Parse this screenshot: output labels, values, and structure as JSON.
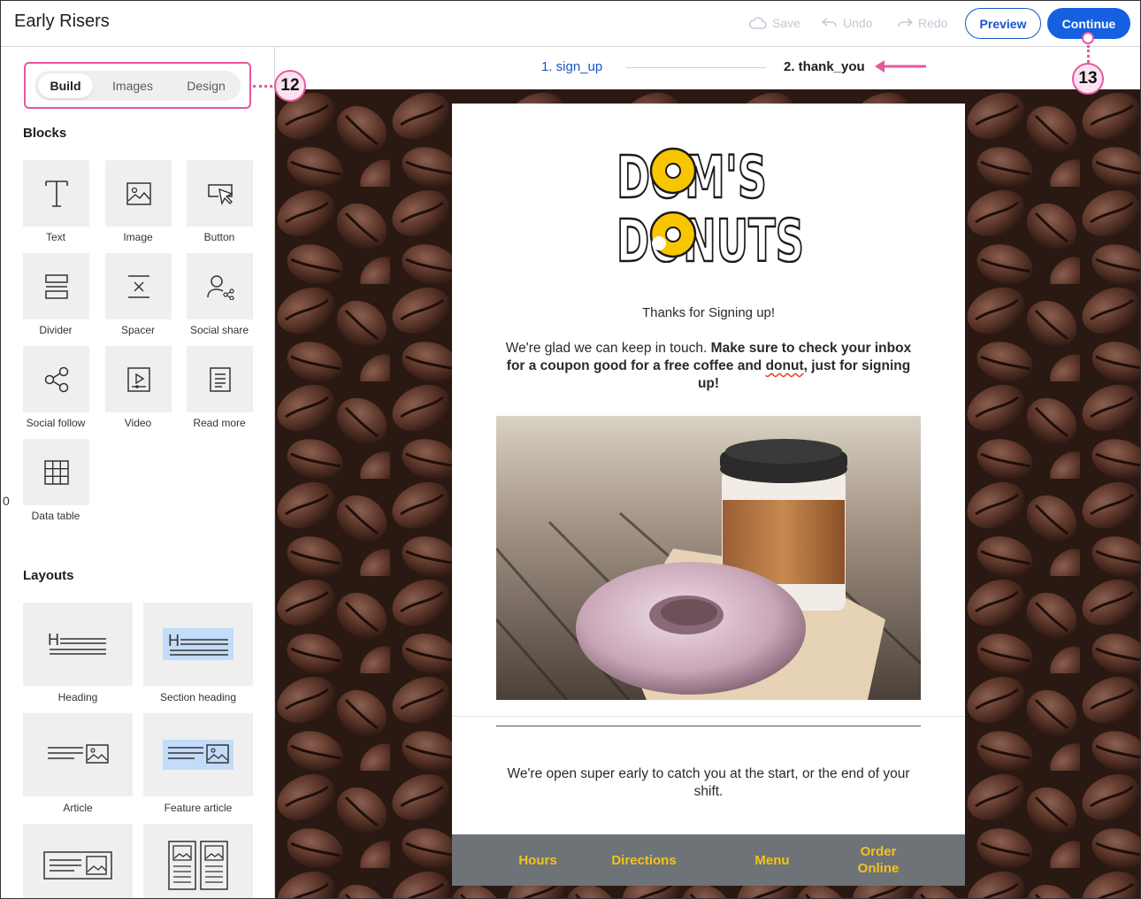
{
  "header": {
    "app_title": "Early Risers",
    "save_label": "Save",
    "undo_label": "Undo",
    "redo_label": "Redo",
    "preview_label": "Preview",
    "continue_label": "Continue"
  },
  "sidebar": {
    "tabs": [
      {
        "label": "Build",
        "active": true
      },
      {
        "label": "Images",
        "active": false
      },
      {
        "label": "Design",
        "active": false
      }
    ],
    "blocks_title": "Blocks",
    "blocks": [
      {
        "label": "Text",
        "icon": "text-icon"
      },
      {
        "label": "Image",
        "icon": "image-icon"
      },
      {
        "label": "Button",
        "icon": "button-cursor-icon"
      },
      {
        "label": "Divider",
        "icon": "divider-icon"
      },
      {
        "label": "Spacer",
        "icon": "spacer-icon"
      },
      {
        "label": "Social share",
        "icon": "social-share-icon"
      },
      {
        "label": "Social follow",
        "icon": "social-follow-icon"
      },
      {
        "label": "Video",
        "icon": "video-icon"
      },
      {
        "label": "Read more",
        "icon": "read-more-icon"
      },
      {
        "label": "Data table",
        "icon": "data-table-icon"
      }
    ],
    "stray_text": "0",
    "layouts_title": "Layouts",
    "layouts": [
      {
        "label": "Heading",
        "icon": "heading-layout-icon"
      },
      {
        "label": "Section heading",
        "icon": "section-heading-layout-icon"
      },
      {
        "label": "Article",
        "icon": "article-layout-icon"
      },
      {
        "label": "Feature article",
        "icon": "feature-article-layout-icon"
      },
      {
        "label": "",
        "icon": "article-image-layout-icon"
      },
      {
        "label": "",
        "icon": "two-column-layout-icon"
      }
    ]
  },
  "callouts": {
    "tabs_callout": "12",
    "continue_callout": "13"
  },
  "steps": {
    "step1": "1.  sign_up",
    "step2": "2.  thank_you"
  },
  "email": {
    "logo_line1": "DOM'S",
    "logo_line2": "DONUTS",
    "heading": "Thanks for Signing up!",
    "body_plain": "We're glad we can keep in touch. ",
    "body_bold_1": "Make sure to check your inbox for a coupon good for a free coffee and ",
    "body_bold_squiggle": "donut",
    "body_bold_2": ", just for signing up!",
    "hours_text": "We're open super early to catch you at the start, or the end of your shift.",
    "footer_links": [
      "Hours",
      "Directions",
      "Menu",
      "Order Online"
    ]
  },
  "colors": {
    "accent_blue": "#1460e0",
    "callout_pink": "#e5589f",
    "logo_yellow": "#f7c600",
    "footer_bg": "#6d7377",
    "footer_link": "#f4c21c"
  }
}
